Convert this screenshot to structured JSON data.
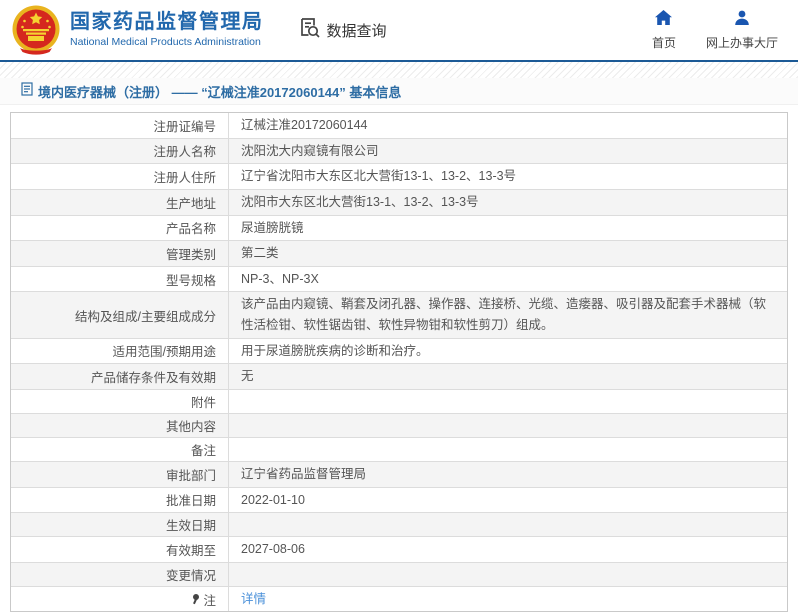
{
  "header": {
    "org_name_cn": "国家药品监督管理局",
    "org_name_en": "National Medical Products Administration",
    "nav_query": "数据查询",
    "nav_home": "首页",
    "nav_hall": "网上办事大厅"
  },
  "breadcrumb": {
    "text": "境内医疗器械（注册） —— “辽械注准20172060144” 基本信息"
  },
  "colors": {
    "brand_blue": "#2268ad",
    "header_line": "#1c5a96",
    "nav_icon_blue": "#1a56b0",
    "breadcrumb_blue": "#2e6da4",
    "link_blue": "#4a90d9",
    "row_alt_bg": "#f4f4f4",
    "table_border": "#c9c9c9"
  },
  "table": {
    "rows": [
      {
        "label": "注册证编号",
        "value": "辽械注准20172060144"
      },
      {
        "label": "注册人名称",
        "value": "沈阳沈大内窥镜有限公司"
      },
      {
        "label": "注册人住所",
        "value": "辽宁省沈阳市大东区北大营街13-1、13-2、13-3号"
      },
      {
        "label": "生产地址",
        "value": "沈阳市大东区北大营街13-1、13-2、13-3号"
      },
      {
        "label": "产品名称",
        "value": "尿道膀胱镜"
      },
      {
        "label": "管理类别",
        "value": "第二类"
      },
      {
        "label": "型号规格",
        "value": "NP-3、NP-3X"
      },
      {
        "label": "结构及组成/主要组成成分",
        "value": "该产品由内窥镜、鞘套及闭孔器、操作器、连接桥、光缆、造瘘器、吸引器及配套手术器械（软性活检钳、软性锯齿钳、软性异物钳和软性剪刀）组成。"
      },
      {
        "label": "适用范围/预期用途",
        "value": "用于尿道膀胱疾病的诊断和治疗。"
      },
      {
        "label": "产品储存条件及有效期",
        "value": "无"
      },
      {
        "label": "附件",
        "value": ""
      },
      {
        "label": "其他内容",
        "value": ""
      },
      {
        "label": "备注",
        "value": ""
      },
      {
        "label": "审批部门",
        "value": "辽宁省药品监督管理局"
      },
      {
        "label": "批准日期",
        "value": "2022-01-10"
      },
      {
        "label": "生效日期",
        "value": ""
      },
      {
        "label": "有效期至",
        "value": "2027-08-06"
      },
      {
        "label": "变更情况",
        "value": ""
      },
      {
        "label": "注",
        "value": "详情",
        "value_is_link": true,
        "has_icon": true
      }
    ]
  }
}
